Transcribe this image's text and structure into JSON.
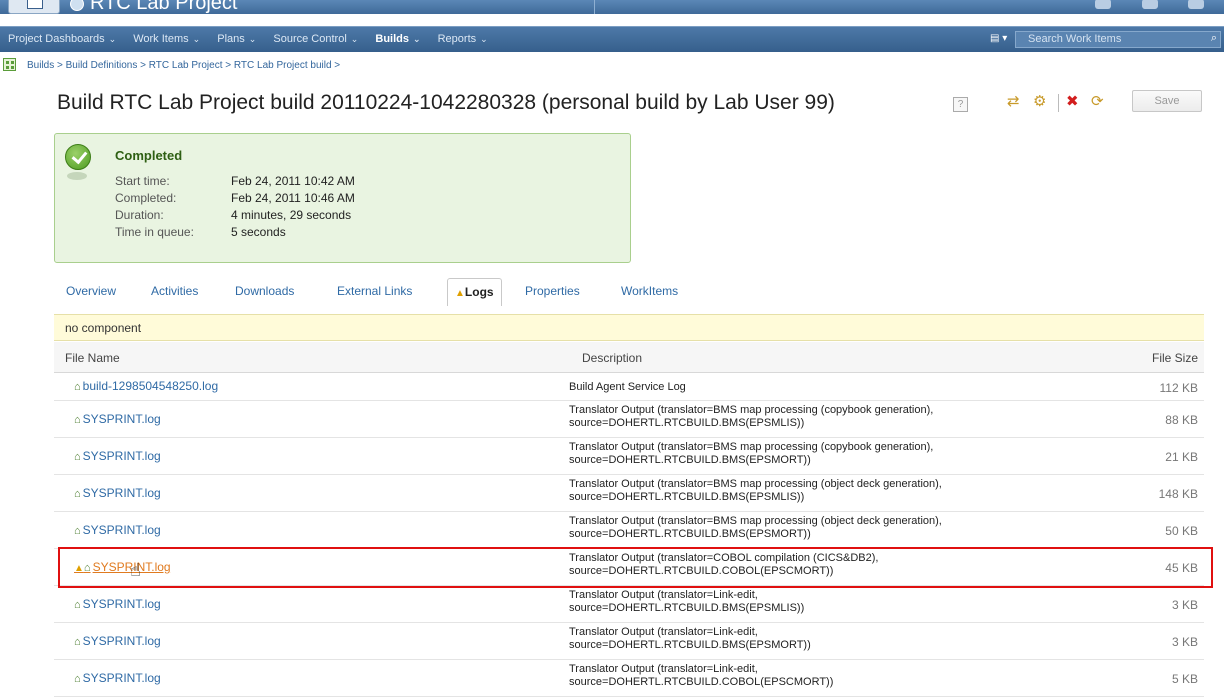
{
  "app": {
    "project_title": "RTC Lab Project",
    "nav_items": [
      "Project Dashboards",
      "Work Items",
      "Plans",
      "Source Control",
      "Builds",
      "Reports"
    ],
    "active_nav": "Builds",
    "search_placeholder": "Search Work Items"
  },
  "breadcrumb": "Builds > Build Definitions > RTC Lab Project > RTC Lab Project build >",
  "page": {
    "title": "Build RTC Lab Project build 20110224-1042280328 (personal build by Lab User 99)",
    "help": "?",
    "save_label": "Save"
  },
  "status": {
    "state": "Completed",
    "rows": [
      {
        "label": "Start time:",
        "value": "Feb 24, 2011 10:42 AM"
      },
      {
        "label": "Completed:",
        "value": "Feb 24, 2011 10:46 AM"
      },
      {
        "label": "Duration:",
        "value": "4 minutes, 29 seconds"
      },
      {
        "label": "Time in queue:",
        "value": "5 seconds"
      }
    ]
  },
  "tabs": [
    "Overview",
    "Activities",
    "Downloads",
    "External Links",
    "Logs",
    "Properties",
    "WorkItems"
  ],
  "active_tab": "Logs",
  "component": "no component",
  "table": {
    "headers": {
      "name": "File Name",
      "description": "Description",
      "size": "File Size"
    },
    "rows": [
      {
        "name": "build-1298504548250.log",
        "desc1": "Build Agent Service Log",
        "desc2": "",
        "size": "112 KB"
      },
      {
        "name": "SYSPRINT.log",
        "desc1": "Translator Output (translator=BMS map processing (copybook generation),",
        "desc2": "source=DOHERTL.RTCBUILD.BMS(EPSMLIS))",
        "size": "88 KB"
      },
      {
        "name": "SYSPRINT.log",
        "desc1": "Translator Output (translator=BMS map processing (copybook generation),",
        "desc2": "source=DOHERTL.RTCBUILD.BMS(EPSMORT))",
        "size": "21 KB"
      },
      {
        "name": "SYSPRINT.log",
        "desc1": "Translator Output (translator=BMS map processing (object deck generation),",
        "desc2": "source=DOHERTL.RTCBUILD.BMS(EPSMLIS))",
        "size": "148 KB"
      },
      {
        "name": "SYSPRINT.log",
        "desc1": "Translator Output (translator=BMS map processing (object deck generation),",
        "desc2": "source=DOHERTL.RTCBUILD.BMS(EPSMORT))",
        "size": "50 KB"
      },
      {
        "name": "SYSPRINT.log",
        "desc1": "Translator Output (translator=COBOL compilation (CICS&DB2),",
        "desc2": "source=DOHERTL.RTCBUILD.COBOL(EPSCMORT))",
        "size": "45 KB"
      },
      {
        "name": "SYSPRINT.log",
        "desc1": "Translator Output (translator=Link-edit,",
        "desc2": "source=DOHERTL.RTCBUILD.BMS(EPSMLIS))",
        "size": "3 KB"
      },
      {
        "name": "SYSPRINT.log",
        "desc1": "Translator Output (translator=Link-edit,",
        "desc2": "source=DOHERTL.RTCBUILD.BMS(EPSMORT))",
        "size": "3 KB"
      },
      {
        "name": "SYSPRINT.log",
        "desc1": "Translator Output (translator=Link-edit,",
        "desc2": "source=DOHERTL.RTCBUILD.COBOL(EPSCMORT))",
        "size": "5 KB"
      }
    ]
  }
}
